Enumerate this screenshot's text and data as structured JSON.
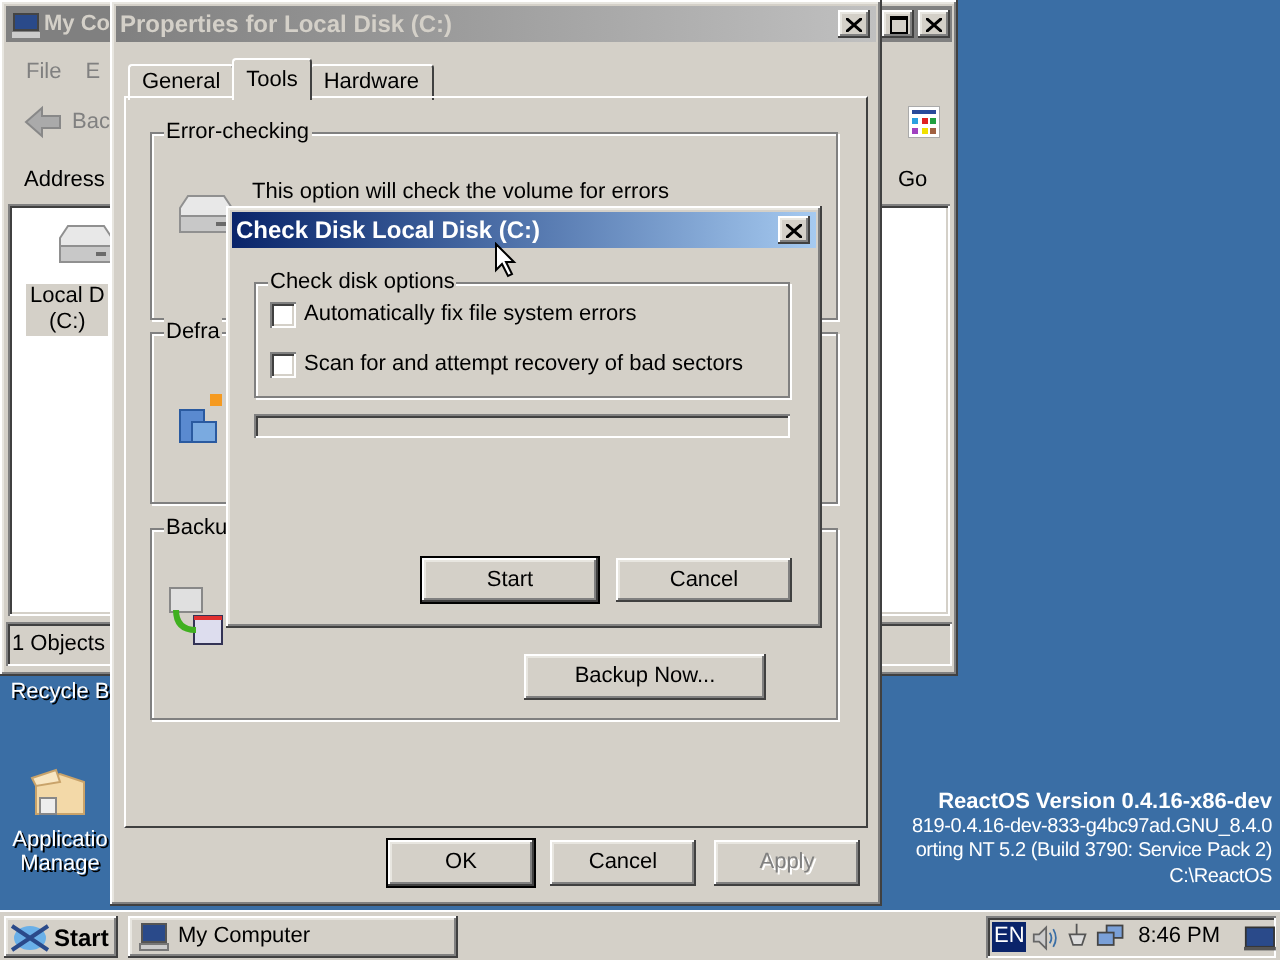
{
  "desktop": {
    "icons": [
      {
        "kind": "label-only",
        "lines": [
          "Recycle B"
        ]
      },
      {
        "kind": "package",
        "lines": [
          "Applicatio",
          "Manage"
        ]
      }
    ],
    "version_text": [
      {
        "text": "ReactOS Version 0.4.16-x86-dev",
        "bold": true
      },
      {
        "text": "819-0.4.16-dev-833-g4bc97ad.GNU_8.4.0",
        "bold": false
      },
      {
        "text": "orting NT 5.2 (Build 3790: Service Pack 2)",
        "bold": false
      },
      {
        "text": "C:\\ReactOS",
        "bold": false
      }
    ]
  },
  "explorer": {
    "title": "My Co",
    "menu": [
      "File",
      "E"
    ],
    "back_label": "Bac",
    "address_label": "Address",
    "go_label": "Go",
    "drive_lines": [
      "Local D",
      "(C:)"
    ],
    "status": "1 Objects"
  },
  "properties": {
    "title": "Properties for Local Disk (C:)",
    "tabs": [
      {
        "label": "General",
        "selected": false
      },
      {
        "label": "Tools",
        "selected": true
      },
      {
        "label": "Hardware",
        "selected": false
      }
    ],
    "error_checking": {
      "title": "Error-checking",
      "text": "This option will check the volume for errors"
    },
    "defrag": {
      "title": "Defra"
    },
    "backup": {
      "title": "Backu",
      "button": "Backup Now..."
    },
    "buttons": [
      {
        "label": "OK",
        "default": true,
        "disabled": false
      },
      {
        "label": "Cancel",
        "default": false,
        "disabled": false
      },
      {
        "label": "Apply",
        "default": false,
        "disabled": true
      }
    ]
  },
  "check_disk": {
    "title": "Check Disk Local Disk (C:)",
    "group_title": "Check disk options",
    "options": [
      {
        "label": "Automatically fix file system errors",
        "checked": false
      },
      {
        "label": "Scan for and attempt recovery of bad sectors",
        "checked": false
      }
    ],
    "progress": {
      "level": 0
    },
    "buttons": [
      {
        "label": "Start",
        "default": true
      },
      {
        "label": "Cancel",
        "default": false
      }
    ]
  },
  "taskbar": {
    "start": "Start",
    "tasks": [
      {
        "label": "My Computer",
        "selected": false
      }
    ],
    "language": "EN",
    "time": "8:46 PM"
  }
}
